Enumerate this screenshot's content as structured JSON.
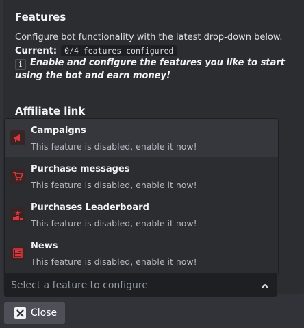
{
  "embed": {
    "title": "Features",
    "description": "Configure bot functionality with the latest drop-down below.",
    "current_label": "Current:",
    "current_value": "0/4 features configured",
    "note_icon": "info-icon",
    "note": "Enable and configure the features you like to start using the bot and earn money!",
    "section_title": "Affiliate link"
  },
  "menu": {
    "options": [
      {
        "label": "Campaigns",
        "description": "This feature is disabled, enable it now!",
        "icon": "megaphone-icon"
      },
      {
        "label": "Purchase messages",
        "description": "This feature is disabled, enable it now!",
        "icon": "cart-icon"
      },
      {
        "label": "Purchases Leaderboard",
        "description": "This feature is disabled, enable it now!",
        "icon": "podium-icon"
      },
      {
        "label": "News",
        "description": "This feature is disabled, enable it now!",
        "icon": "newspaper-icon"
      }
    ]
  },
  "select": {
    "placeholder": "Select a feature to configure",
    "icon": "chevron-up-icon"
  },
  "close_button": {
    "label": "Close",
    "icon": "close-icon"
  },
  "colors": {
    "background": "#313338",
    "embed": "#2b2d31",
    "accent_red": "#da373c",
    "button": "#4e5058"
  }
}
